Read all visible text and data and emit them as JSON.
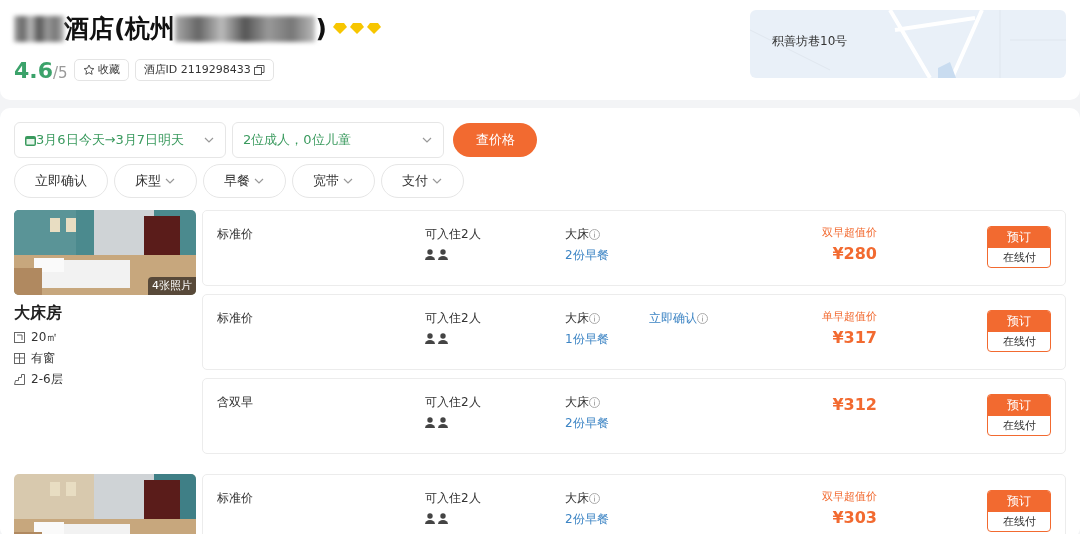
{
  "hotel": {
    "title_start": "酒店(杭州",
    "title_end": ")",
    "stars": 3,
    "rating": "4.6",
    "rating_max": "/5",
    "favorite": "收藏",
    "hotel_id": "酒店ID 2119298433"
  },
  "map": {
    "address": "积善坊巷10号"
  },
  "search": {
    "dates": "3月6日今天→3月7日明天",
    "guests": "2位成人，0位儿童",
    "button": "查价格"
  },
  "filters": [
    {
      "label": "立即确认",
      "dropdown": false
    },
    {
      "label": "床型",
      "dropdown": true
    },
    {
      "label": "早餐",
      "dropdown": true
    },
    {
      "label": "宽带",
      "dropdown": true
    },
    {
      "label": "支付",
      "dropdown": true
    }
  ],
  "rooms": [
    {
      "name": "大床房",
      "photo_count": "4张照片",
      "facts": [
        {
          "kind": "area",
          "text": "20㎡"
        },
        {
          "kind": "window",
          "text": "有窗"
        },
        {
          "kind": "floor",
          "text": "2-6层"
        }
      ],
      "offers": [
        {
          "plan": "标准价",
          "occupancy": "可入住2人",
          "bed": "大床",
          "breakfast": "2份早餐",
          "promo": "双早超值价",
          "price": "¥280",
          "book": "预订",
          "pay": "在线付"
        },
        {
          "plan": "标准价",
          "occupancy": "可入住2人",
          "bed": "大床",
          "breakfast": "1份早餐",
          "confirm": "立即确认",
          "promo": "单早超值价",
          "price": "¥317",
          "book": "预订",
          "pay": "在线付"
        },
        {
          "plan": "含双早",
          "occupancy": "可入住2人",
          "bed": "大床",
          "breakfast": "2份早餐",
          "price": "¥312",
          "book": "预订",
          "pay": "在线付"
        }
      ]
    },
    {
      "offers": [
        {
          "plan": "标准价",
          "occupancy": "可入住2人",
          "bed": "大床",
          "breakfast": "2份早餐",
          "promo": "双早超值价",
          "price": "¥303",
          "book": "预订",
          "pay": "在线付"
        }
      ]
    }
  ]
}
